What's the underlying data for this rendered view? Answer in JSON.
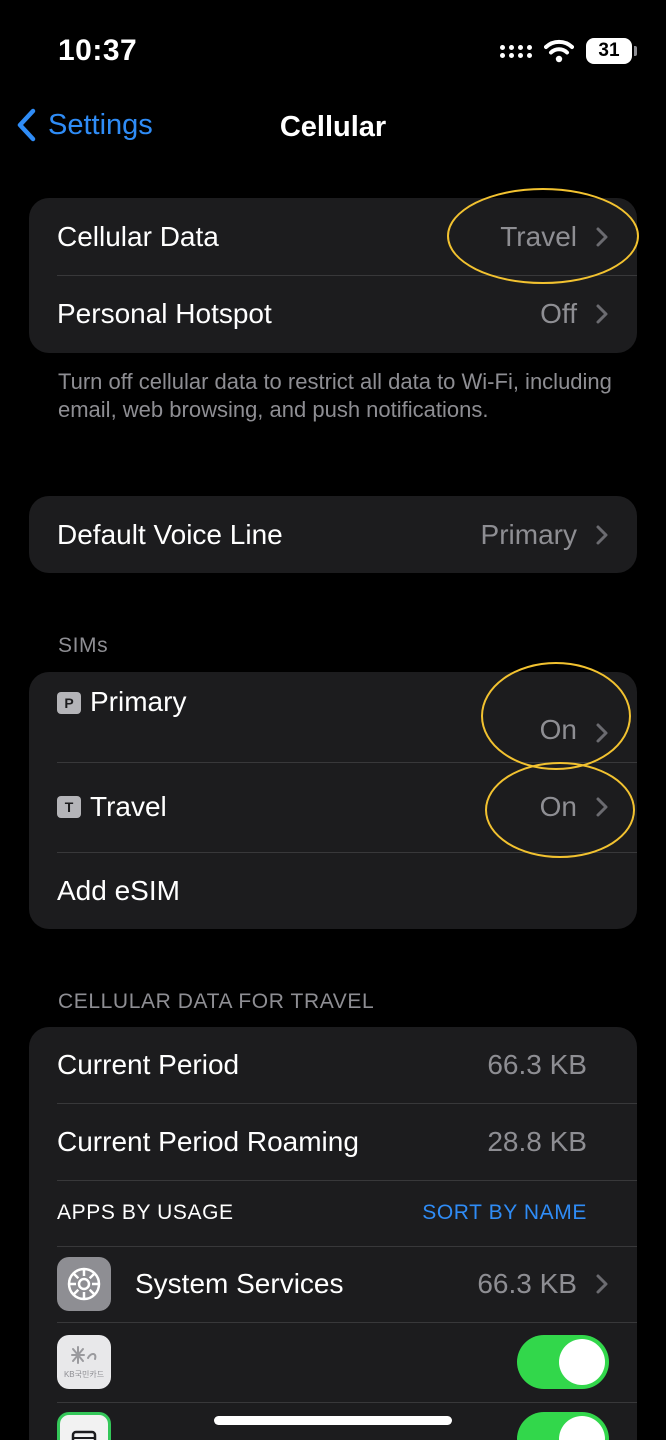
{
  "status_bar": {
    "time": "10:37",
    "battery": "31",
    "icons": [
      "signal-dots-icon",
      "wifi-icon",
      "battery-icon"
    ]
  },
  "nav": {
    "back_label": "Settings",
    "title": "Cellular"
  },
  "group1": {
    "cellular_data": {
      "label": "Cellular Data",
      "value": "Travel"
    },
    "personal_hotspot": {
      "label": "Personal Hotspot",
      "value": "Off"
    }
  },
  "footnote": "Turn off cellular data to restrict all data to Wi-Fi, including email, web browsing, and push notifications.",
  "voice": {
    "label": "Default Voice Line",
    "value": "Primary"
  },
  "sims": {
    "header": "SIMs",
    "items": [
      {
        "badge": "P",
        "label": "Primary",
        "value": "On"
      },
      {
        "badge": "T",
        "label": "Travel",
        "value": "On"
      }
    ],
    "add_label": "Add eSIM"
  },
  "usage": {
    "header": "CELLULAR DATA FOR TRAVEL",
    "current_period": {
      "label": "Current Period",
      "value": "66.3 KB"
    },
    "roaming": {
      "label": "Current Period Roaming",
      "value": "28.8 KB"
    },
    "apps_header": "APPS BY USAGE",
    "sort_label": "SORT BY NAME",
    "system_services": {
      "label": "System Services",
      "value": "66.3 KB"
    },
    "kb_app_icon_text": "KB국민카드"
  },
  "colors": {
    "accent": "#2f8cf6",
    "toggle_on": "#32d74b",
    "annotation": "#f2c230",
    "cell_bg": "#1c1c1e"
  }
}
